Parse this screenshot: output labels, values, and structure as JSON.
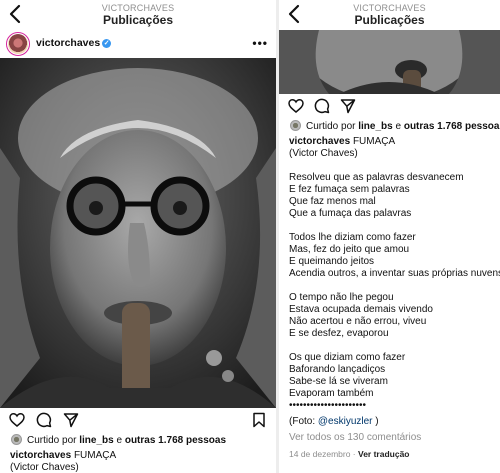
{
  "header": {
    "subtitle": "VICTORCHAVES",
    "title": "Publicações"
  },
  "post": {
    "username": "victorchaves",
    "liked_prefix": "Curtido por ",
    "liked_user": "line_bs",
    "liked_mid": " e ",
    "liked_count": "outras 1.768 pessoas",
    "caption_title": "FUMAÇA",
    "caption_author": "(Victor Chaves)",
    "left_caption_partial": "(Victor Chaves)",
    "stanzas": [
      [
        "Resolveu que as palavras desvanecem",
        "E fez fumaça sem palavras",
        "Que faz menos mal",
        "Que a fumaça das palavras"
      ],
      [
        "Todos lhe diziam como fazer",
        "Mas, fez do jeito que amou",
        "E queimando jeitos",
        "Acendia outros, a inventar suas próprias nuvens"
      ],
      [
        "O tempo não lhe pegou",
        "Estava ocupada demais vivendo",
        "Não acertou e não errou, viveu",
        "E se desfez, evaporou"
      ],
      [
        "Os que diziam como fazer",
        "Baforando lançadiços",
        "Sabe-se lá se viveram",
        "Evaporam também",
        "••••••••••••••••••••••"
      ]
    ],
    "photo_credit_open": "(Foto: ",
    "photo_credit_tag": "@eskiyuzler",
    "photo_credit_close": " )",
    "view_comments": "Ver todos os 130 comentários",
    "date": "14 de dezembro",
    "date_sep": " · ",
    "translate": "Ver tradução"
  },
  "icons": {
    "back": "chevron-left-icon",
    "more": "more-options-icon",
    "like": "heart-icon",
    "comment": "comment-icon",
    "share": "send-icon",
    "save": "bookmark-icon",
    "verified": "verified-badge-icon"
  },
  "colors": {
    "link": "#00376b",
    "verified": "#3897f0",
    "muted": "#8e8e8e"
  }
}
